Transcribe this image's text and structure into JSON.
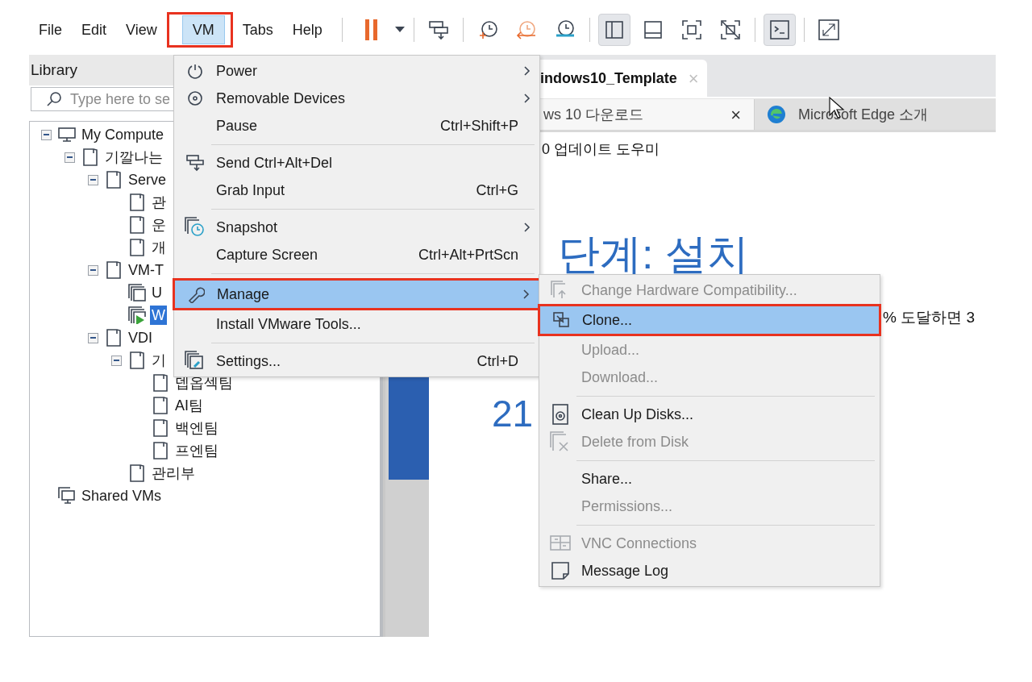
{
  "menubar": [
    {
      "label": "File",
      "selected": false,
      "annotated": false
    },
    {
      "label": "Edit",
      "selected": false,
      "annotated": false
    },
    {
      "label": "View",
      "selected": false,
      "annotated": false
    },
    {
      "label": "VM",
      "selected": true,
      "annotated": true
    },
    {
      "label": "Tabs",
      "selected": false,
      "annotated": false
    },
    {
      "label": "Help",
      "selected": false,
      "annotated": false
    }
  ],
  "toolbar": [
    {
      "pressed": false
    },
    {
      "pressed": false
    },
    {
      "pressed": false
    },
    {
      "pressed": false
    },
    {
      "pressed": false
    },
    {
      "pressed": false
    },
    {
      "pressed": true
    },
    {
      "pressed": false
    },
    {
      "pressed": false
    },
    {
      "pressed": false
    },
    {
      "pressed": true
    },
    {
      "pressed": false
    }
  ],
  "library": {
    "title": "Library",
    "search": {
      "placeholder": "Type here to se"
    },
    "tree": [
      {
        "label": "My Compute",
        "kind": "computer",
        "expanded": true,
        "selected": false,
        "children": [
          {
            "label": "기깔나는",
            "kind": "folder",
            "expanded": true,
            "selected": false,
            "children": [
              {
                "label": "Serve",
                "kind": "folder",
                "expanded": true,
                "selected": false,
                "children": [
                  {
                    "label": "관",
                    "kind": "folder",
                    "selected": false
                  },
                  {
                    "label": "운",
                    "kind": "folder",
                    "selected": false
                  },
                  {
                    "label": "개",
                    "kind": "folder",
                    "selected": false
                  }
                ]
              },
              {
                "label": "VM-T",
                "kind": "folder",
                "expanded": true,
                "selected": false,
                "children": [
                  {
                    "label": "U",
                    "kind": "vm",
                    "selected": false
                  },
                  {
                    "label": "W",
                    "kind": "vm-running",
                    "selected": true
                  }
                ]
              },
              {
                "label": "VDI",
                "kind": "folder",
                "expanded": true,
                "selected": false,
                "children": [
                  {
                    "label": "기",
                    "kind": "folder",
                    "expanded": true,
                    "selected": false,
                    "children": [
                      {
                        "label": "뎁옵섹팀",
                        "kind": "folder",
                        "selected": false
                      },
                      {
                        "label": "AI팀",
                        "kind": "folder",
                        "selected": false
                      },
                      {
                        "label": "백엔팀",
                        "kind": "folder",
                        "selected": false
                      },
                      {
                        "label": "프엔팀",
                        "kind": "folder",
                        "selected": false
                      }
                    ]
                  },
                  {
                    "label": "관리부",
                    "kind": "folder",
                    "selected": false
                  }
                ]
              }
            ]
          }
        ]
      },
      {
        "label": "Shared VMs",
        "kind": "shared",
        "selected": false
      }
    ]
  },
  "tabs": [
    {
      "label": "indows10_Template",
      "selected": true,
      "close": "×"
    }
  ],
  "guest": {
    "browser_tabs": [
      {
        "label": "ws 10 다운로드",
        "selected": true,
        "close": "×"
      },
      {
        "label": "Microsoft Edge 소개",
        "selected": false
      }
    ],
    "app_title": "0 업데이트 도우미",
    "step_title": "단계: 설치",
    "note": "% 도달하면 3",
    "progress": "21"
  },
  "vm_menu": [
    {
      "kind": "item",
      "label": "Power",
      "submenu": true,
      "disabled": false,
      "selected": false,
      "annotated": false
    },
    {
      "kind": "item",
      "label": "Removable Devices",
      "submenu": true,
      "disabled": false,
      "selected": false,
      "annotated": false
    },
    {
      "kind": "item",
      "label": "Pause",
      "shortcut": "Ctrl+Shift+P",
      "submenu": false,
      "disabled": false,
      "selected": false,
      "annotated": false
    },
    {
      "kind": "separator"
    },
    {
      "kind": "item",
      "label": "Send Ctrl+Alt+Del",
      "submenu": false,
      "disabled": false,
      "selected": false,
      "annotated": false
    },
    {
      "kind": "item",
      "label": "Grab Input",
      "shortcut": "Ctrl+G",
      "submenu": false,
      "disabled": false,
      "selected": false,
      "annotated": false
    },
    {
      "kind": "separator"
    },
    {
      "kind": "item",
      "label": "Snapshot",
      "submenu": true,
      "disabled": false,
      "selected": false,
      "annotated": false
    },
    {
      "kind": "item",
      "label": "Capture Screen",
      "shortcut": "Ctrl+Alt+PrtScn",
      "submenu": false,
      "disabled": false,
      "selected": false,
      "annotated": false
    },
    {
      "kind": "separator"
    },
    {
      "kind": "item",
      "label": "Manage",
      "submenu": true,
      "disabled": false,
      "selected": true,
      "annotated": true
    },
    {
      "kind": "item",
      "label": "Install VMware Tools...",
      "submenu": false,
      "disabled": false,
      "selected": false,
      "annotated": false
    },
    {
      "kind": "separator"
    },
    {
      "kind": "item",
      "label": "Settings...",
      "shortcut": "Ctrl+D",
      "submenu": false,
      "disabled": false,
      "selected": false,
      "annotated": false
    }
  ],
  "manage_menu": [
    {
      "kind": "item",
      "label": "Change Hardware Compatibility...",
      "disabled": true,
      "selected": false,
      "annotated": false
    },
    {
      "kind": "item",
      "label": "Clone...",
      "disabled": false,
      "selected": true,
      "annotated": true
    },
    {
      "kind": "item",
      "label": "Upload...",
      "disabled": true,
      "selected": false,
      "annotated": false
    },
    {
      "kind": "item",
      "label": "Download...",
      "disabled": true,
      "selected": false,
      "annotated": false
    },
    {
      "kind": "separator"
    },
    {
      "kind": "item",
      "label": "Clean Up Disks...",
      "disabled": false,
      "selected": false,
      "annotated": false
    },
    {
      "kind": "item",
      "label": "Delete from Disk",
      "disabled": true,
      "selected": false,
      "annotated": false
    },
    {
      "kind": "separator"
    },
    {
      "kind": "item",
      "label": "Share...",
      "disabled": false,
      "selected": false,
      "annotated": false
    },
    {
      "kind": "item",
      "label": "Permissions...",
      "disabled": true,
      "selected": false,
      "annotated": false
    },
    {
      "kind": "separator"
    },
    {
      "kind": "item",
      "label": "VNC Connections",
      "disabled": true,
      "selected": false,
      "annotated": false
    },
    {
      "kind": "item",
      "label": "Message Log",
      "disabled": false,
      "selected": false,
      "annotated": false
    }
  ]
}
